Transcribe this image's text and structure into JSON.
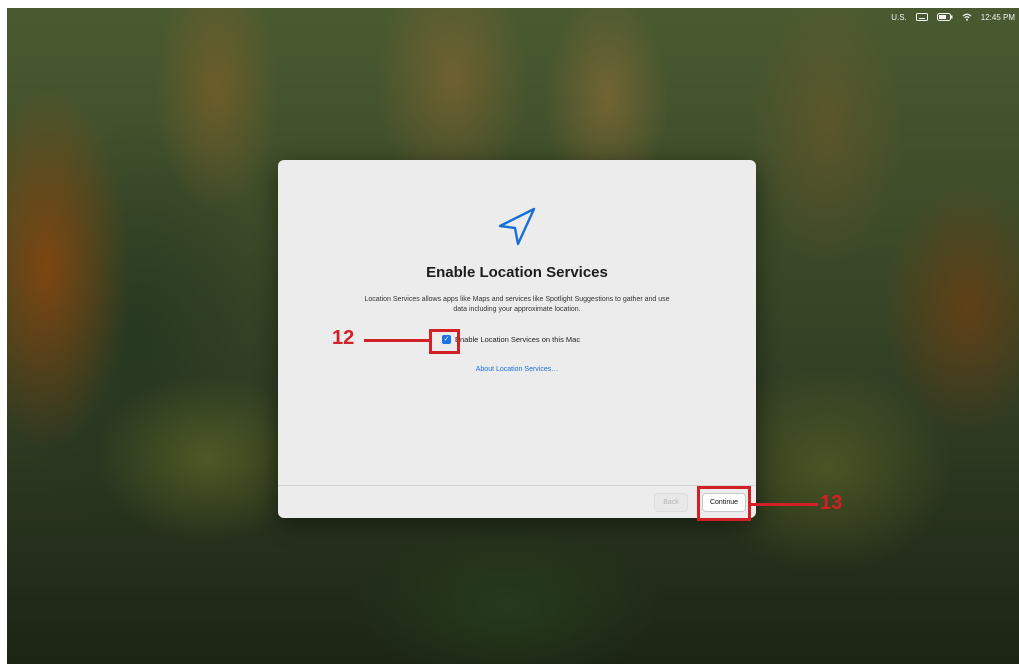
{
  "menubar": {
    "keyboard_layout": "U.S.",
    "keyboard_icon": "keyboard-icon",
    "battery_icon": "battery-icon",
    "wifi_icon": "wifi-icon",
    "time": "12:45 PM"
  },
  "dialog": {
    "icon": "location-arrow-icon",
    "icon_color": "#1a6fd6",
    "title": "Enable Location Services",
    "description": "Location Services allows apps like Maps and services like Spotlight Suggestions to gather and use data including your approximate location.",
    "checkbox_label": "Enable Location Services on this Mac",
    "checkbox_checked": true,
    "about_link": "About Location Services…",
    "back_label": "Back",
    "continue_label": "Continue"
  },
  "annotations": {
    "callout_12": "12",
    "callout_13": "13",
    "color": "#d31f26"
  }
}
